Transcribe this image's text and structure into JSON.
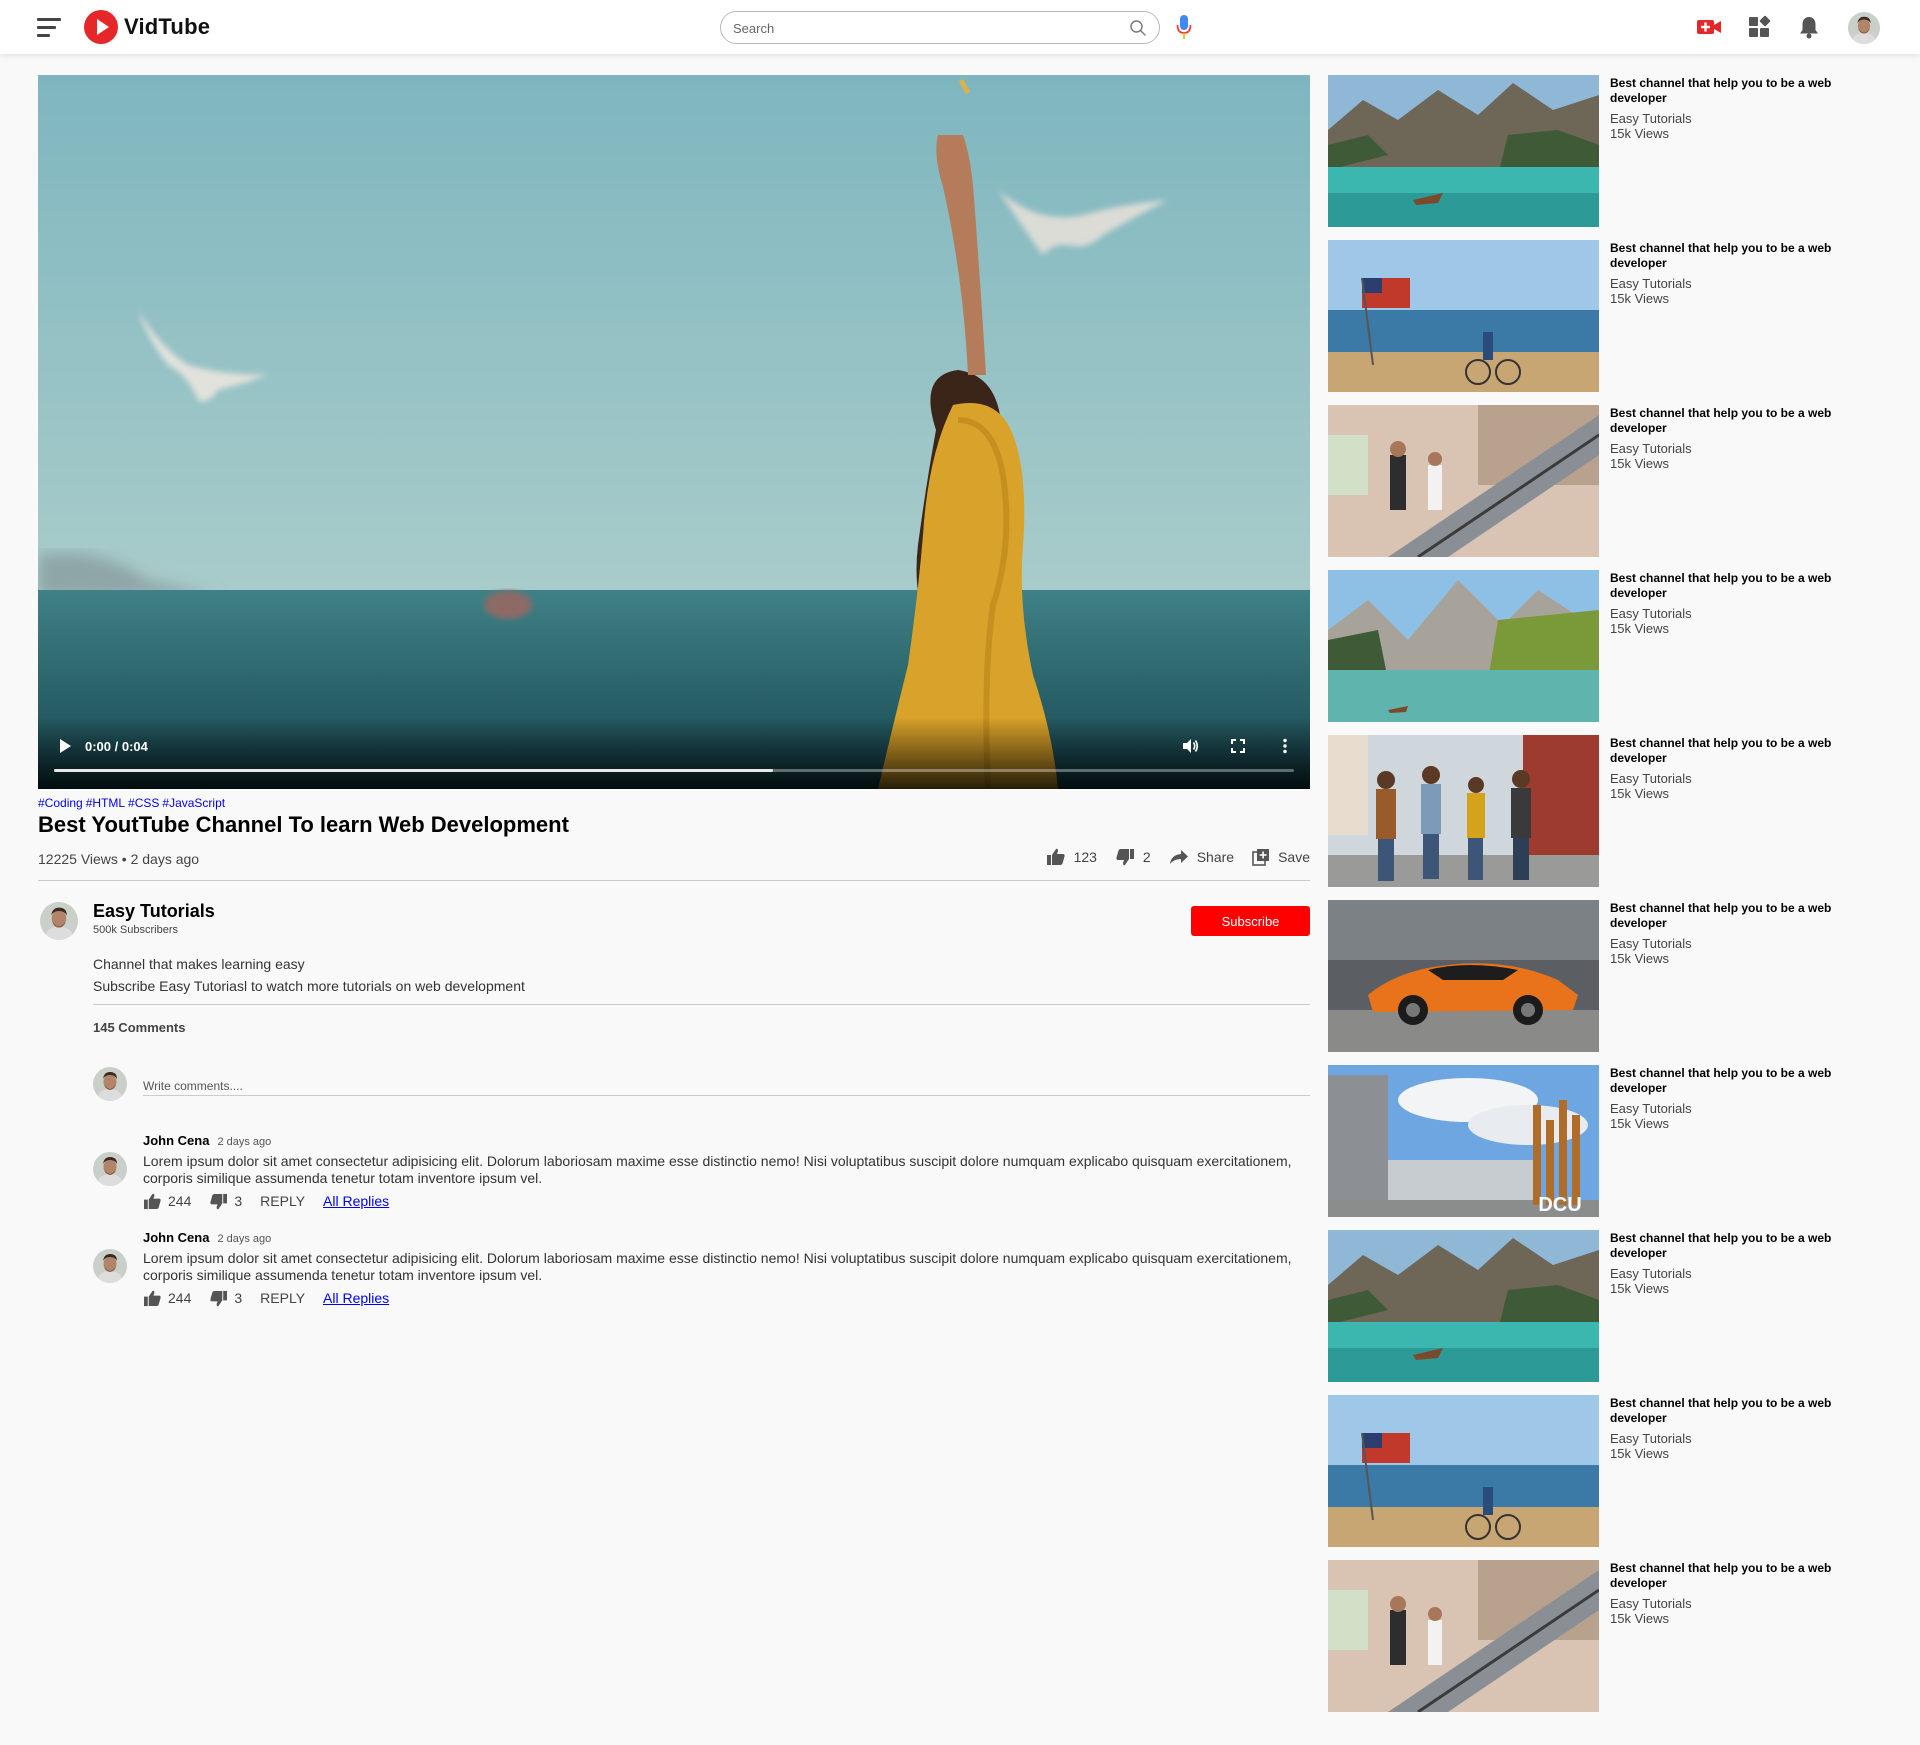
{
  "navbar": {
    "brand": "VidTube",
    "search_placeholder": "Search",
    "icons": [
      "menu-icon",
      "search-icon",
      "mic-icon",
      "upload-video-icon",
      "apps-icon",
      "notifications-icon",
      "profile-avatar"
    ]
  },
  "player": {
    "time": "0:00 / 0:04",
    "progress": 0.58
  },
  "video": {
    "tags": [
      "#Coding",
      "#HTML",
      "#CSS",
      "#JavaScript"
    ],
    "title": "Best YoutTube Channel To learn Web Development",
    "views": "12225 Views • 2 days ago",
    "likes": "123",
    "dislikes": "2",
    "share_label": "Share",
    "save_label": "Save"
  },
  "channel": {
    "name": "Easy Tutorials",
    "subscribers": "500k Subscribers",
    "subscribe_label": "Subscribe",
    "description": [
      "Channel that makes learning easy",
      "Subscribe Easy Tutoriasl to watch more tutorials on web development"
    ]
  },
  "comments": {
    "count_label": "145 Comments",
    "input_placeholder": "Write comments....",
    "items": [
      {
        "name": "John Cena",
        "date": "2 days ago",
        "text": "Lorem ipsum dolor sit amet consectetur adipisicing elit. Dolorum laboriosam maxime esse distinctio nemo! Nisi voluptatibus suscipit dolore numquam explicabo quisquam exercitationem, corporis similique assumenda tenetur totam inventore ipsum vel.",
        "likes": "244",
        "dislikes": "3",
        "reply_label": "REPLY",
        "all_replies_label": "All Replies"
      },
      {
        "name": "John Cena",
        "date": "2 days ago",
        "text": "Lorem ipsum dolor sit amet consectetur adipisicing elit. Dolorum laboriosam maxime esse distinctio nemo! Nisi voluptatibus suscipit dolore numquam explicabo quisquam exercitationem, corporis similique assumenda tenetur totam inventore ipsum vel.",
        "likes": "244",
        "dislikes": "3",
        "reply_label": "REPLY",
        "all_replies_label": "All Replies"
      }
    ]
  },
  "sidebar": {
    "items": [
      {
        "title": "Best channel that help you to be a web developer",
        "channel": "Easy Tutorials",
        "views": "15k Views",
        "thumb": "lake-mountains"
      },
      {
        "title": "Best channel that help you to be a web developer",
        "channel": "Easy Tutorials",
        "views": "15k Views",
        "thumb": "flag-beach"
      },
      {
        "title": "Best channel that help you to be a web developer",
        "channel": "Easy Tutorials",
        "views": "15k Views",
        "thumb": "escalator-people"
      },
      {
        "title": "Best channel that help you to be a web developer",
        "channel": "Easy Tutorials",
        "views": "15k Views",
        "thumb": "alpine-lake"
      },
      {
        "title": "Best channel that help you to be a web developer",
        "channel": "Easy Tutorials",
        "views": "15k Views",
        "thumb": "friends-walking"
      },
      {
        "title": "Best channel that help you to be a web developer",
        "channel": "Easy Tutorials",
        "views": "15k Views",
        "thumb": "orange-car"
      },
      {
        "title": "Best channel that help you to be a web developer",
        "channel": "Easy Tutorials",
        "views": "15k Views",
        "thumb": "dcu-campus",
        "thumb_text": "DCU"
      },
      {
        "title": "Best channel that help you to be a web developer",
        "channel": "Easy Tutorials",
        "views": "15k Views",
        "thumb": "lake-mountains"
      },
      {
        "title": "Best channel that help you to be a web developer",
        "channel": "Easy Tutorials",
        "views": "15k Views",
        "thumb": "flag-beach"
      },
      {
        "title": "Best channel that help you to be a web developer",
        "channel": "Easy Tutorials",
        "views": "15k Views",
        "thumb": "escalator-people"
      }
    ]
  },
  "colors": {
    "brand_red": "#e5272a",
    "subscribe_red": "#ff0000",
    "link_blue": "#0000ee"
  }
}
